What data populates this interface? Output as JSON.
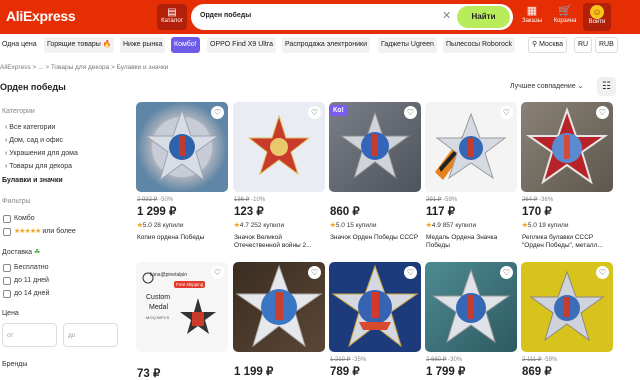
{
  "header": {
    "logo": "AliExpress",
    "catalog": "Каталог",
    "search_query": "Орден победы",
    "search_btn": "Найти",
    "orders": "Заказы",
    "cart": "Корзина",
    "login": "Войти"
  },
  "chips": [
    "Одна цена",
    "Горящие товары",
    "Ниже рынка",
    "Комбо!",
    "OPPO Find X9 Ultra",
    "Распродажа электроники",
    "Гаджеты Ugreen",
    "Пылесосы Roborock",
    "Москва",
    "RU",
    "RUB"
  ],
  "breadcrumbs": "AliExpress  >  ...  >  Товары для декора  >  Булавки и значки",
  "page_title": "Орден победы",
  "sort": "Лучшее совпадение",
  "sidebar": {
    "cat_head": "Категории",
    "cats": [
      "‹  Все категории",
      "‹  Дом, сад и офис",
      "‹  Украшения для дома",
      "‹  Товары для декора",
      "Булавки и значки"
    ],
    "filters_head": "Фильтры",
    "combo": "Комбо",
    "rating": "или более",
    "delivery_head": "Доставка",
    "delivery": [
      "Бесплатно",
      "до 11 дней",
      "до 14 дней"
    ],
    "price_head": "Цена",
    "price_from": "от",
    "price_to": "до",
    "brands_head": "Бренды"
  },
  "products": [
    {
      "old": "2 932 ₽",
      "disc": "-50%",
      "price": "1 299 ₽",
      "rating": "5.0",
      "sold": "28 купили",
      "title": "Копия ордена Победы"
    },
    {
      "old": "136 ₽",
      "disc": "-10%",
      "price": "123 ₽",
      "rating": "4.7",
      "sold": "252 купили",
      "title": "Значок Великой Отечественной войны 2..."
    },
    {
      "old": "",
      "disc": "",
      "price": "860 ₽",
      "rating": "5.0",
      "sold": "15 купили",
      "title": "Значок Орден Победы СССР"
    },
    {
      "old": "291 ₽",
      "disc": "-59%",
      "price": "117 ₽",
      "rating": "4.9",
      "sold": "857 купили",
      "title": "Медаль Ордена Значка Победы"
    },
    {
      "old": "264 ₽",
      "disc": "-36%",
      "price": "170 ₽",
      "rating": "5.0",
      "sold": "19 купили",
      "title": "Реплика булавки СССР \"Орден Победы\", металл..."
    },
    {
      "old": "",
      "disc": "",
      "price": "73 ₽",
      "rating": "",
      "sold": "",
      "title": ""
    },
    {
      "old": "",
      "disc": "",
      "price": "1 199 ₽",
      "rating": "",
      "sold": "",
      "title": ""
    },
    {
      "old": "1 210 ₽",
      "disc": "-35%",
      "price": "789 ₽",
      "rating": "",
      "sold": "",
      "title": ""
    },
    {
      "old": "2 660 ₽",
      "disc": "-30%",
      "price": "1 799 ₽",
      "rating": "",
      "sold": "",
      "title": ""
    },
    {
      "old": "2 111 ₽",
      "disc": "-59%",
      "price": "869 ₽",
      "rating": "",
      "sold": "",
      "title": ""
    }
  ],
  "promo": {
    "badge": "Ко!",
    "store": "liana@pinetalpin",
    "ship": "Free shipping",
    "custom": "Custom",
    "medal": "Medal",
    "moq": "MOQ:50PCS"
  }
}
